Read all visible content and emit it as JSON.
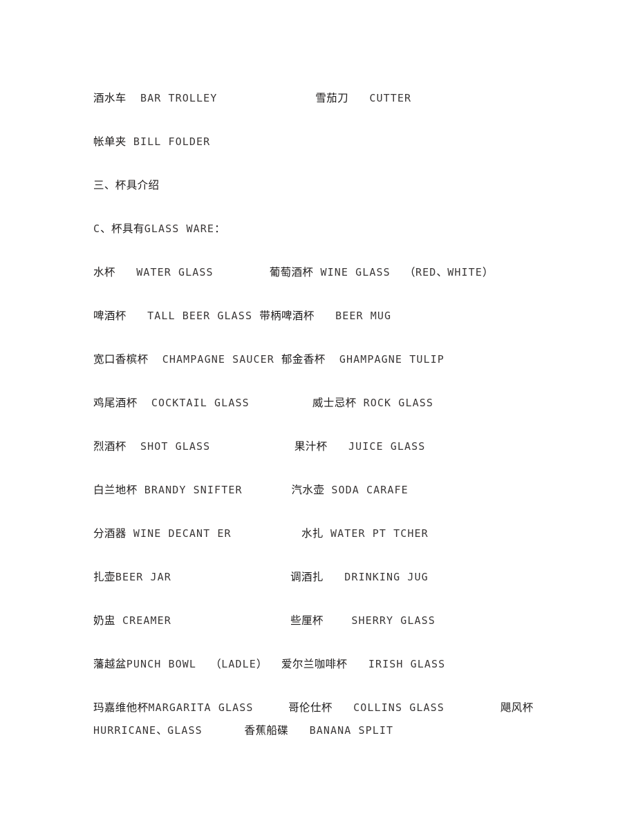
{
  "document": {
    "lines": [
      {
        "name": "line-bar-trolley",
        "segments": [
          {
            "type": "cn",
            "text": "酒水车"
          },
          {
            "type": "gap",
            "text": "  "
          },
          {
            "type": "en",
            "text": "BAR TROLLEY"
          },
          {
            "type": "gap",
            "text": "              "
          },
          {
            "type": "cn",
            "text": "雪茄刀"
          },
          {
            "type": "gap",
            "text": "   "
          },
          {
            "type": "en",
            "text": "CUTTER"
          }
        ]
      },
      {
        "name": "line-bill-folder",
        "segments": [
          {
            "type": "cn",
            "text": "帐单夹"
          },
          {
            "type": "gap",
            "text": " "
          },
          {
            "type": "en",
            "text": "BILL FOLDER"
          }
        ]
      },
      {
        "name": "line-section-heading",
        "segments": [
          {
            "type": "cn",
            "text": "三、杯具介绍"
          }
        ]
      },
      {
        "name": "line-subheading-glassware",
        "segments": [
          {
            "type": "en",
            "text": "C"
          },
          {
            "type": "cn",
            "text": "、杯具有"
          },
          {
            "type": "en",
            "text": "GLASS WARE"
          },
          {
            "type": "cn",
            "text": "："
          }
        ]
      },
      {
        "name": "line-water-wine-glass",
        "segments": [
          {
            "type": "cn",
            "text": "水杯"
          },
          {
            "type": "gap",
            "text": "   "
          },
          {
            "type": "en",
            "text": "WATER GLASS"
          },
          {
            "type": "gap",
            "text": "        "
          },
          {
            "type": "cn",
            "text": "葡萄酒杯"
          },
          {
            "type": "gap",
            "text": " "
          },
          {
            "type": "en",
            "text": "WINE GLASS"
          },
          {
            "type": "gap",
            "text": "  "
          },
          {
            "type": "cn",
            "text": "（"
          },
          {
            "type": "en",
            "text": "RED"
          },
          {
            "type": "cn",
            "text": "、"
          },
          {
            "type": "en",
            "text": "WHITE"
          },
          {
            "type": "cn",
            "text": "）"
          }
        ]
      },
      {
        "name": "line-beer-glass-mug",
        "segments": [
          {
            "type": "cn",
            "text": "啤酒杯"
          },
          {
            "type": "gap",
            "text": "   "
          },
          {
            "type": "en",
            "text": "TALL BEER GLASS"
          },
          {
            "type": "gap",
            "text": " "
          },
          {
            "type": "cn",
            "text": "带柄啤酒杯"
          },
          {
            "type": "gap",
            "text": "   "
          },
          {
            "type": "en",
            "text": "BEER MUG"
          }
        ]
      },
      {
        "name": "line-champagne-saucer-tulip",
        "segments": [
          {
            "type": "cn",
            "text": "宽口香槟杯"
          },
          {
            "type": "gap",
            "text": "  "
          },
          {
            "type": "en",
            "text": "CHAMPAGNE SAUCER"
          },
          {
            "type": "gap",
            "text": " "
          },
          {
            "type": "cn",
            "text": "郁金香杯"
          },
          {
            "type": "gap",
            "text": "  "
          },
          {
            "type": "en",
            "text": "GHAMPAGNE TULIP"
          }
        ]
      },
      {
        "name": "line-cocktail-rock-glass",
        "segments": [
          {
            "type": "cn",
            "text": "鸡尾酒杯"
          },
          {
            "type": "gap",
            "text": "  "
          },
          {
            "type": "en",
            "text": "COCKTAIL GLASS"
          },
          {
            "type": "gap",
            "text": "         "
          },
          {
            "type": "cn",
            "text": "威士忌杯"
          },
          {
            "type": "gap",
            "text": " "
          },
          {
            "type": "en",
            "text": "ROCK GLASS"
          }
        ]
      },
      {
        "name": "line-shot-juice-glass",
        "segments": [
          {
            "type": "cn",
            "text": "烈酒杯"
          },
          {
            "type": "gap",
            "text": "  "
          },
          {
            "type": "en",
            "text": "SHOT GLASS"
          },
          {
            "type": "gap",
            "text": "            "
          },
          {
            "type": "cn",
            "text": "果汁杯"
          },
          {
            "type": "gap",
            "text": "   "
          },
          {
            "type": "en",
            "text": "JUICE GLASS"
          }
        ]
      },
      {
        "name": "line-brandy-soda-carafe",
        "segments": [
          {
            "type": "cn",
            "text": "白兰地杯"
          },
          {
            "type": "gap",
            "text": " "
          },
          {
            "type": "en",
            "text": "BRANDY SNIFTER"
          },
          {
            "type": "gap",
            "text": "       "
          },
          {
            "type": "cn",
            "text": "汽水壶"
          },
          {
            "type": "gap",
            "text": " "
          },
          {
            "type": "en",
            "text": "SODA CARAFE"
          }
        ]
      },
      {
        "name": "line-wine-decanter-water-pitcher",
        "segments": [
          {
            "type": "cn",
            "text": "分酒器"
          },
          {
            "type": "gap",
            "text": " "
          },
          {
            "type": "en",
            "text": "WINE DECANT ER"
          },
          {
            "type": "gap",
            "text": "          "
          },
          {
            "type": "cn",
            "text": "水扎"
          },
          {
            "type": "gap",
            "text": " "
          },
          {
            "type": "en",
            "text": "WATER PT TCHER"
          }
        ]
      },
      {
        "name": "line-beer-jar-drinking-jug",
        "segments": [
          {
            "type": "cn",
            "text": "扎壶"
          },
          {
            "type": "en",
            "text": "BEER JAR"
          },
          {
            "type": "gap",
            "text": "                 "
          },
          {
            "type": "cn",
            "text": "调酒扎"
          },
          {
            "type": "gap",
            "text": "   "
          },
          {
            "type": "en",
            "text": "DRINKING JUG"
          }
        ]
      },
      {
        "name": "line-creamer-sherry-glass",
        "segments": [
          {
            "type": "cn",
            "text": "奶盅"
          },
          {
            "type": "gap",
            "text": " "
          },
          {
            "type": "en",
            "text": "CREAMER"
          },
          {
            "type": "gap",
            "text": "                 "
          },
          {
            "type": "cn",
            "text": "些厘杯"
          },
          {
            "type": "gap",
            "text": "    "
          },
          {
            "type": "en",
            "text": "SHERRY GLASS"
          }
        ]
      },
      {
        "name": "line-punch-bowl-irish-glass",
        "segments": [
          {
            "type": "cn",
            "text": "藩越盆"
          },
          {
            "type": "en",
            "text": "PUNCH BOWL"
          },
          {
            "type": "gap",
            "text": "  "
          },
          {
            "type": "cn",
            "text": "（"
          },
          {
            "type": "en",
            "text": "LADLE"
          },
          {
            "type": "cn",
            "text": "）"
          },
          {
            "type": "gap",
            "text": "  "
          },
          {
            "type": "cn",
            "text": "爱尔兰咖啡杯"
          },
          {
            "type": "gap",
            "text": "   "
          },
          {
            "type": "en",
            "text": "IRISH GLASS"
          }
        ]
      },
      {
        "name": "line-margarita-collins-hurricane",
        "wrapped": true,
        "segments": [
          {
            "type": "cn",
            "text": "玛嘉维他杯"
          },
          {
            "type": "en",
            "text": "MARGARITA GLASS"
          },
          {
            "type": "gap",
            "text": "     "
          },
          {
            "type": "cn",
            "text": "哥伦仕杯"
          },
          {
            "type": "gap",
            "text": "   "
          },
          {
            "type": "en",
            "text": "COLLINS GLASS"
          },
          {
            "type": "gap",
            "text": "        "
          },
          {
            "type": "cn",
            "text": "飓风杯"
          }
        ],
        "segments_second": [
          {
            "type": "en",
            "text": "HURRICANE"
          },
          {
            "type": "cn",
            "text": "、"
          },
          {
            "type": "en",
            "text": "GLASS"
          },
          {
            "type": "gap",
            "text": "      "
          },
          {
            "type": "cn",
            "text": "香蕉船碟"
          },
          {
            "type": "gap",
            "text": "   "
          },
          {
            "type": "en",
            "text": "BANANA SPLIT"
          }
        ]
      }
    ]
  }
}
